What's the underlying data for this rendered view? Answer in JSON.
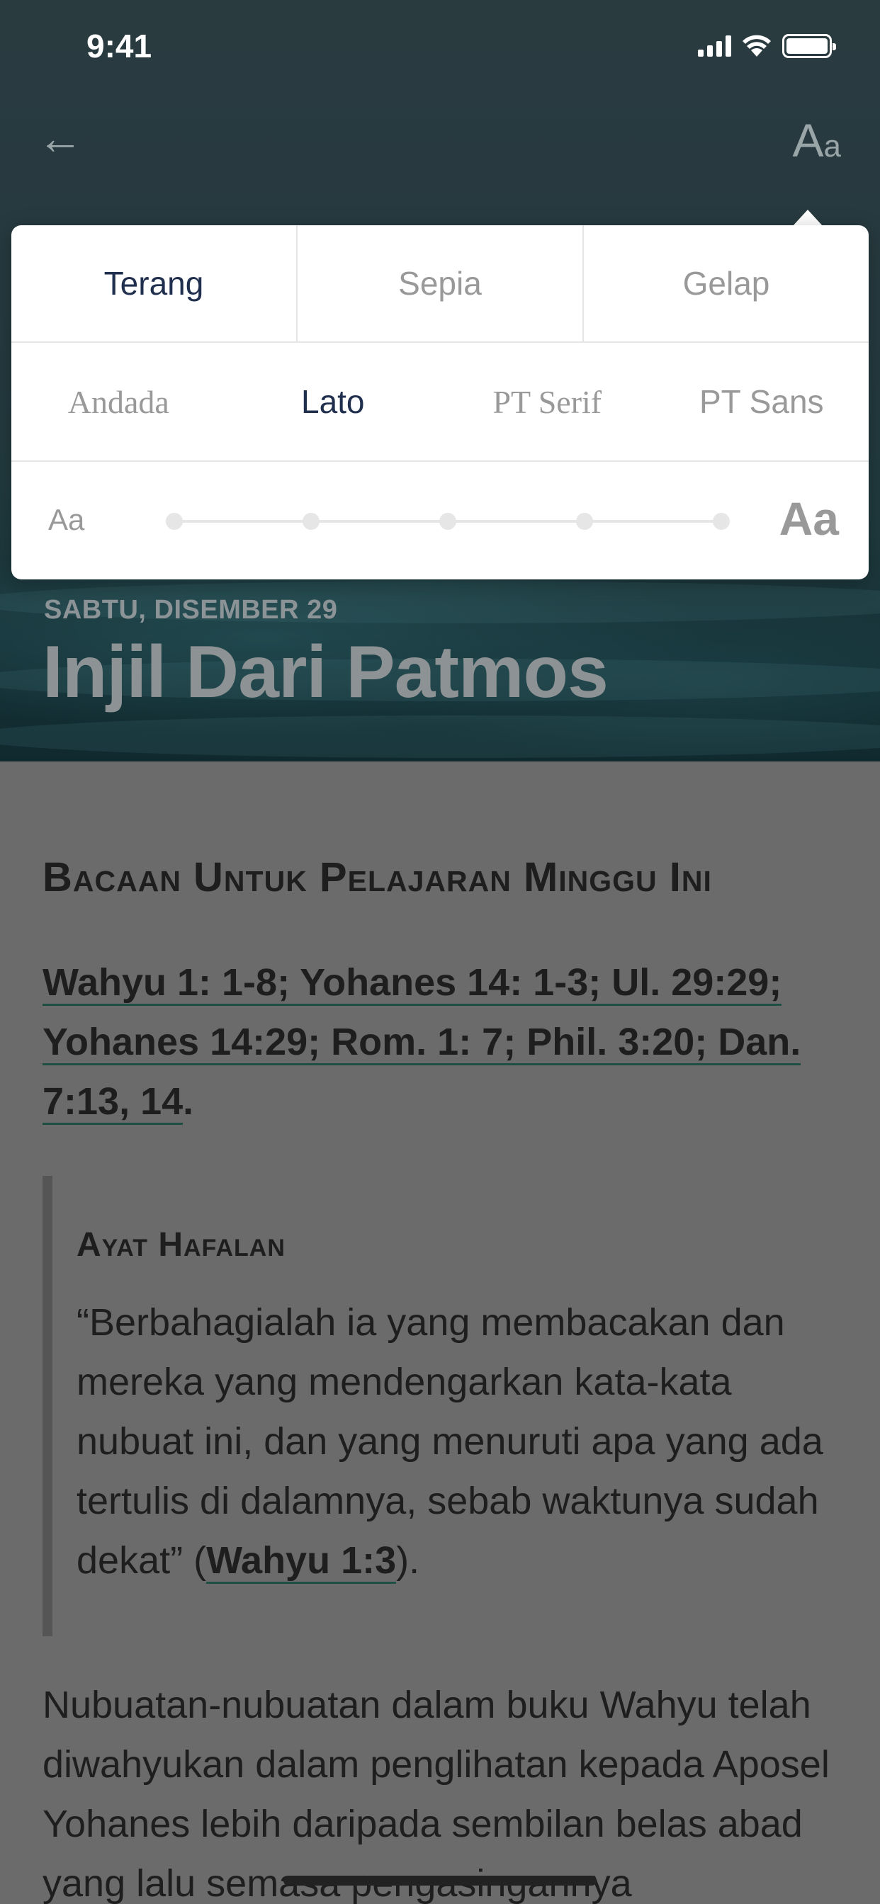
{
  "status": {
    "time": "9:41"
  },
  "header": {
    "font_button": {
      "big": "A",
      "small": "a"
    }
  },
  "hero": {
    "date": "SABTU, DISEMBER 29",
    "title": "Injil Dari Patmos"
  },
  "settings": {
    "themes": [
      "Terang",
      "Sepia",
      "Gelap"
    ],
    "active_theme": "Terang",
    "fonts": [
      "Andada",
      "Lato",
      "PT Serif",
      "PT Sans"
    ],
    "active_font": "Lato",
    "size_small_label": "Aa",
    "size_large_label": "Aa",
    "size_steps": 5
  },
  "lesson": {
    "section_title": "Bacaan Untuk Pelajaran Minggu Ini",
    "readings": {
      "r1": "Wahyu 1: 1-8; Yohanes 14: 1-3; Ul. 29:29;",
      "r2": "Yohanes 14:29; Rom. 1: 7; Phil. 3:20; Dan.",
      "r3": "7:13, 14",
      "end": "."
    },
    "memory_title": "Ayat Hafalan",
    "memory_text": "“Berbahagialah ia yang membacakan dan mereka yang mendengarkan kata-kata nubuat ini, dan yang menuruti apa yang ada tertulis di dalamnya, sebab waktunya sudah dekat” (",
    "memory_ref": "Wahyu 1:3",
    "memory_end": ").",
    "body": "Nubuatan-nubuatan dalam buku Wahyu telah diwahyukan dalam penglihatan kepada Aposel Yohanes lebih daripada sembilan belas abad yang lalu semasa pengasingannya"
  },
  "colors": {
    "accent": "#1f2f4d",
    "link_underline": "#1f4f43",
    "overlay": "#6b6b6b"
  }
}
